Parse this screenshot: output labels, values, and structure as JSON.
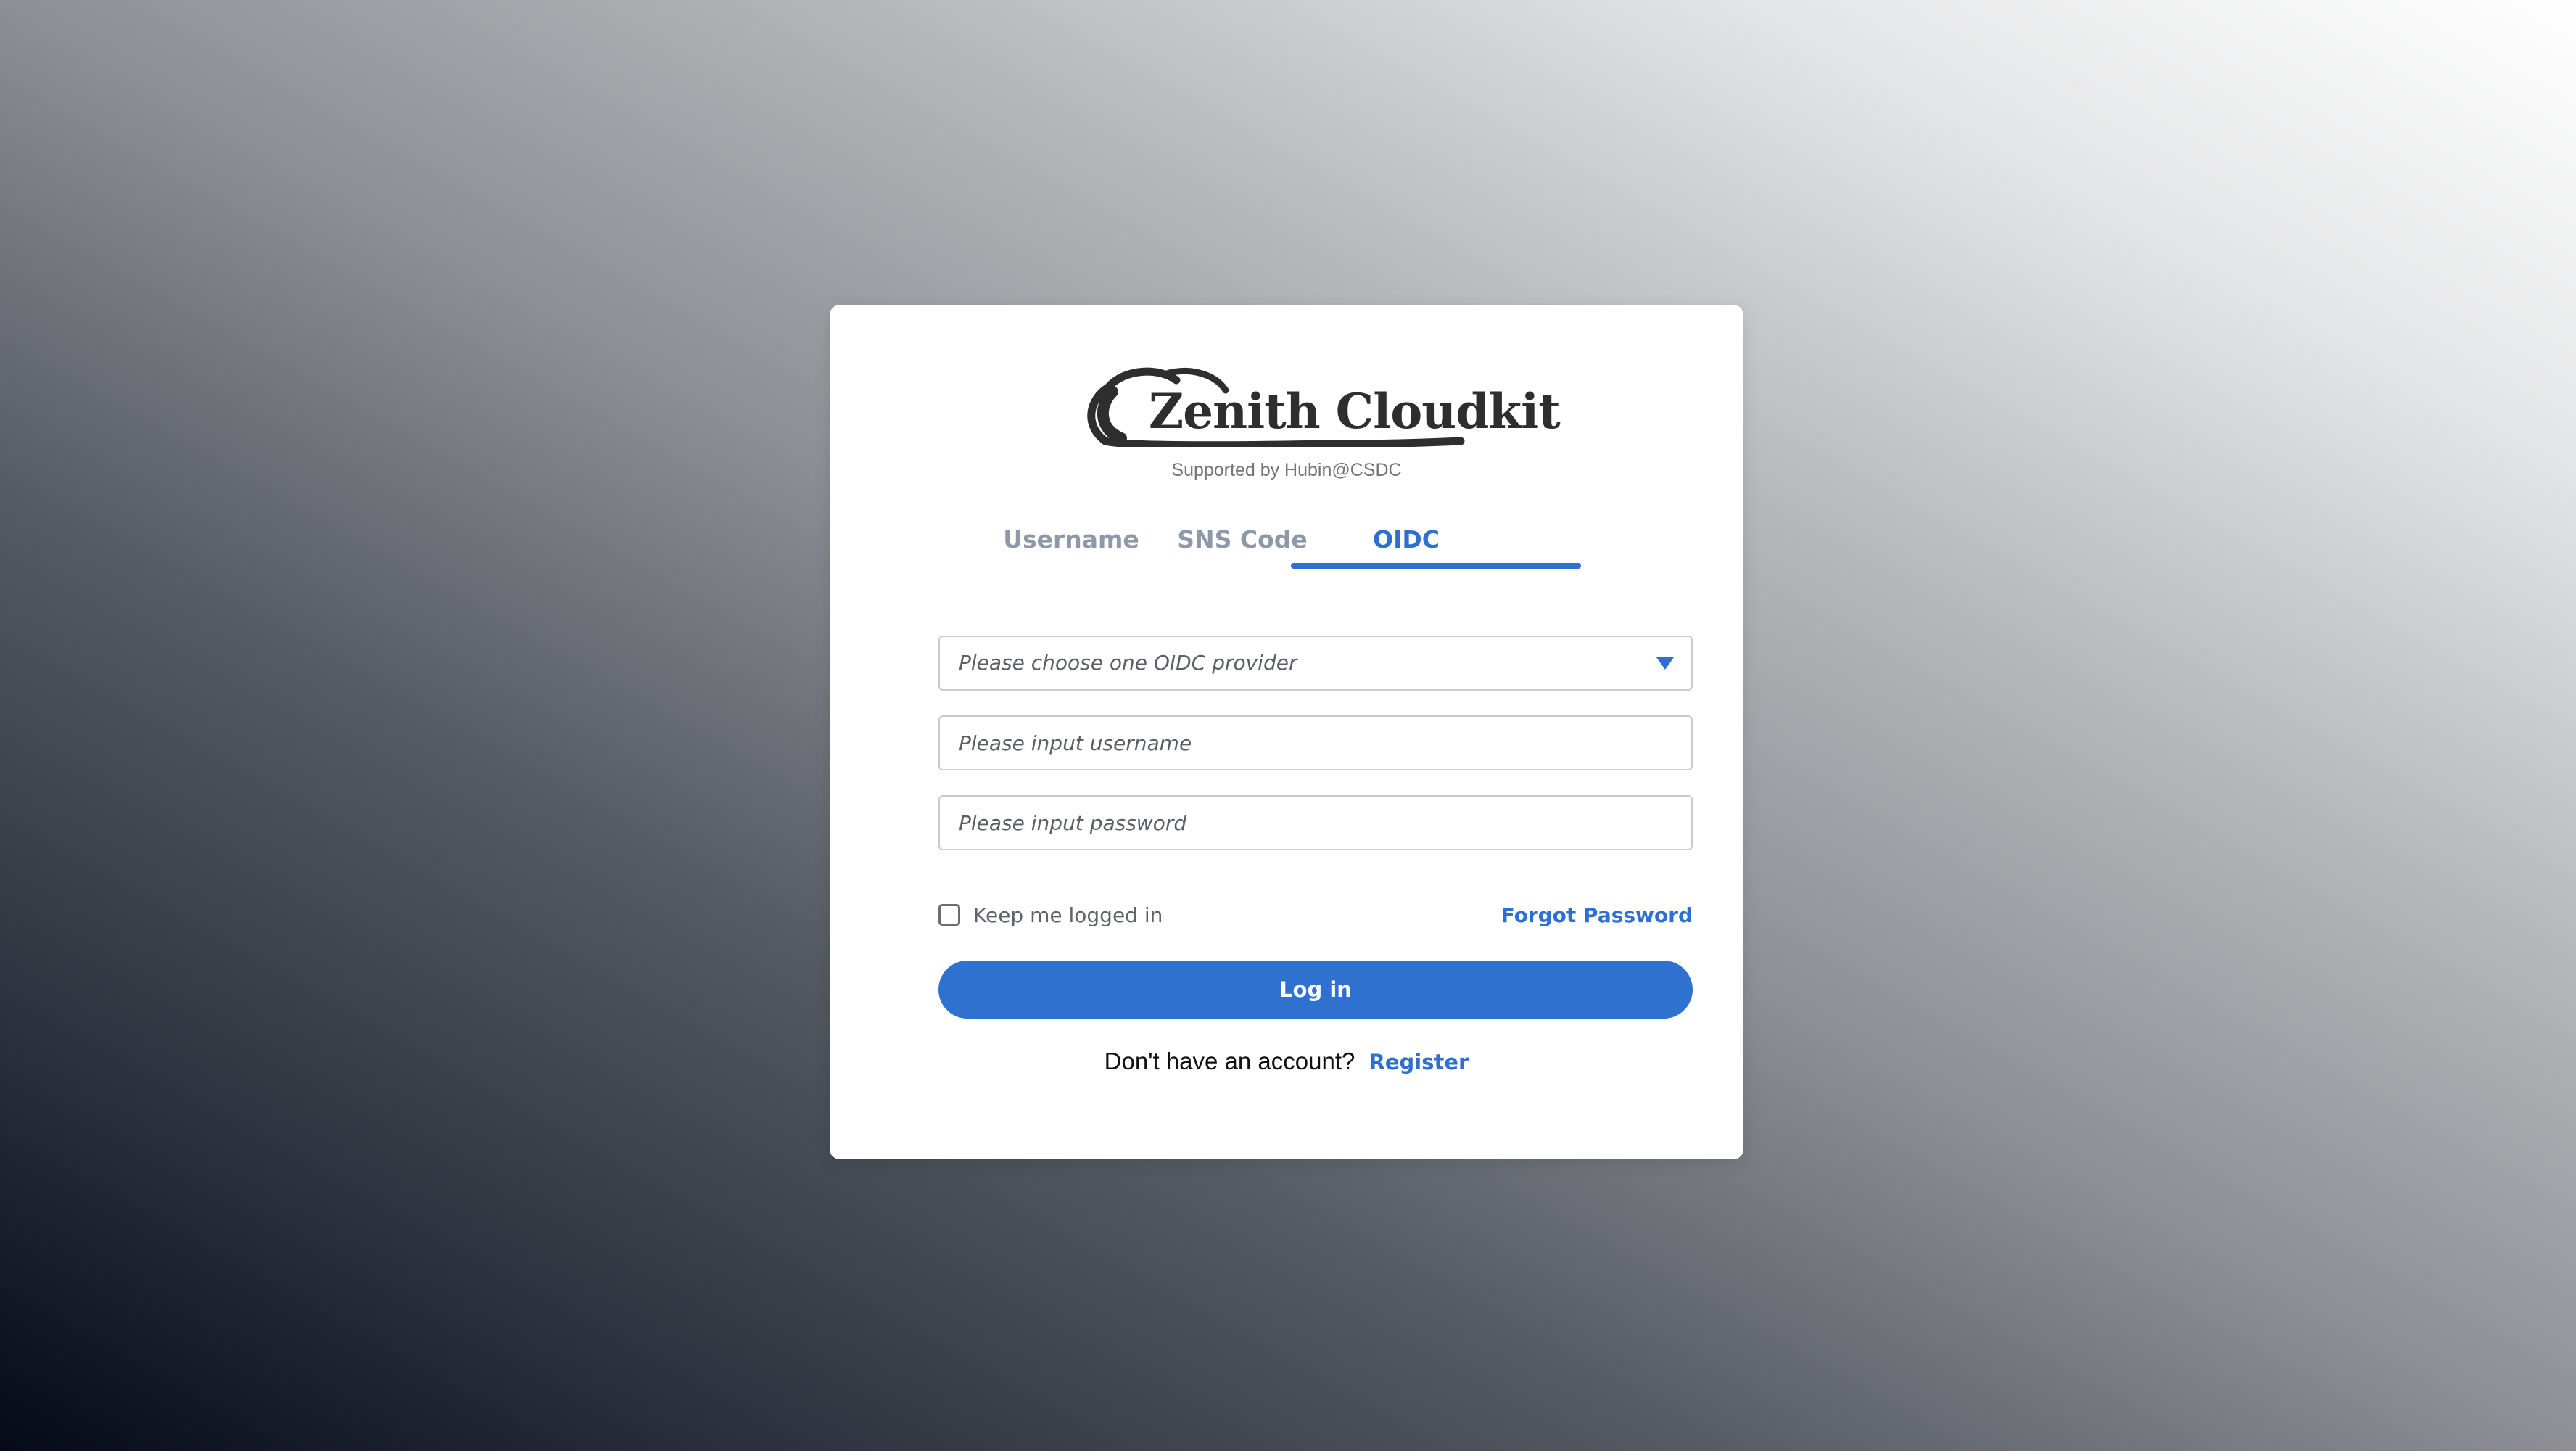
{
  "brand": {
    "logo_text": "Zenith Cloudkit",
    "supported_by": "Supported by Hubin@CSDC"
  },
  "tabs": [
    {
      "label": "Username",
      "active": false
    },
    {
      "label": "SNS Code",
      "active": false
    },
    {
      "label": "OIDC",
      "active": true
    }
  ],
  "form": {
    "provider_select": {
      "placeholder": "Please choose one OIDC provider",
      "value": ""
    },
    "username": {
      "placeholder": "Please input username",
      "value": ""
    },
    "password": {
      "placeholder": "Please input password",
      "value": ""
    },
    "keep_logged_in": {
      "label": "Keep me logged in",
      "checked": false
    },
    "forgot_password": "Forgot Password",
    "login_button": "Log in"
  },
  "footer": {
    "prompt": "Don't have an account?",
    "register": "Register"
  },
  "colors": {
    "accent": "#2f6fd0",
    "tab_inactive": "#8f98a8",
    "card": "#ffffff"
  }
}
